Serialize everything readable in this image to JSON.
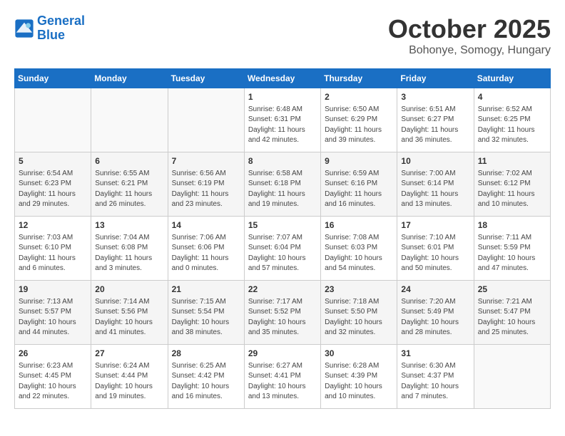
{
  "header": {
    "logo_line1": "General",
    "logo_line2": "Blue",
    "month": "October 2025",
    "location": "Bohonye, Somogy, Hungary"
  },
  "weekdays": [
    "Sunday",
    "Monday",
    "Tuesday",
    "Wednesday",
    "Thursday",
    "Friday",
    "Saturday"
  ],
  "weeks": [
    [
      {
        "day": "",
        "text": ""
      },
      {
        "day": "",
        "text": ""
      },
      {
        "day": "",
        "text": ""
      },
      {
        "day": "1",
        "text": "Sunrise: 6:48 AM\nSunset: 6:31 PM\nDaylight: 11 hours\nand 42 minutes."
      },
      {
        "day": "2",
        "text": "Sunrise: 6:50 AM\nSunset: 6:29 PM\nDaylight: 11 hours\nand 39 minutes."
      },
      {
        "day": "3",
        "text": "Sunrise: 6:51 AM\nSunset: 6:27 PM\nDaylight: 11 hours\nand 36 minutes."
      },
      {
        "day": "4",
        "text": "Sunrise: 6:52 AM\nSunset: 6:25 PM\nDaylight: 11 hours\nand 32 minutes."
      }
    ],
    [
      {
        "day": "5",
        "text": "Sunrise: 6:54 AM\nSunset: 6:23 PM\nDaylight: 11 hours\nand 29 minutes."
      },
      {
        "day": "6",
        "text": "Sunrise: 6:55 AM\nSunset: 6:21 PM\nDaylight: 11 hours\nand 26 minutes."
      },
      {
        "day": "7",
        "text": "Sunrise: 6:56 AM\nSunset: 6:19 PM\nDaylight: 11 hours\nand 23 minutes."
      },
      {
        "day": "8",
        "text": "Sunrise: 6:58 AM\nSunset: 6:18 PM\nDaylight: 11 hours\nand 19 minutes."
      },
      {
        "day": "9",
        "text": "Sunrise: 6:59 AM\nSunset: 6:16 PM\nDaylight: 11 hours\nand 16 minutes."
      },
      {
        "day": "10",
        "text": "Sunrise: 7:00 AM\nSunset: 6:14 PM\nDaylight: 11 hours\nand 13 minutes."
      },
      {
        "day": "11",
        "text": "Sunrise: 7:02 AM\nSunset: 6:12 PM\nDaylight: 11 hours\nand 10 minutes."
      }
    ],
    [
      {
        "day": "12",
        "text": "Sunrise: 7:03 AM\nSunset: 6:10 PM\nDaylight: 11 hours\nand 6 minutes."
      },
      {
        "day": "13",
        "text": "Sunrise: 7:04 AM\nSunset: 6:08 PM\nDaylight: 11 hours\nand 3 minutes."
      },
      {
        "day": "14",
        "text": "Sunrise: 7:06 AM\nSunset: 6:06 PM\nDaylight: 11 hours\nand 0 minutes."
      },
      {
        "day": "15",
        "text": "Sunrise: 7:07 AM\nSunset: 6:04 PM\nDaylight: 10 hours\nand 57 minutes."
      },
      {
        "day": "16",
        "text": "Sunrise: 7:08 AM\nSunset: 6:03 PM\nDaylight: 10 hours\nand 54 minutes."
      },
      {
        "day": "17",
        "text": "Sunrise: 7:10 AM\nSunset: 6:01 PM\nDaylight: 10 hours\nand 50 minutes."
      },
      {
        "day": "18",
        "text": "Sunrise: 7:11 AM\nSunset: 5:59 PM\nDaylight: 10 hours\nand 47 minutes."
      }
    ],
    [
      {
        "day": "19",
        "text": "Sunrise: 7:13 AM\nSunset: 5:57 PM\nDaylight: 10 hours\nand 44 minutes."
      },
      {
        "day": "20",
        "text": "Sunrise: 7:14 AM\nSunset: 5:56 PM\nDaylight: 10 hours\nand 41 minutes."
      },
      {
        "day": "21",
        "text": "Sunrise: 7:15 AM\nSunset: 5:54 PM\nDaylight: 10 hours\nand 38 minutes."
      },
      {
        "day": "22",
        "text": "Sunrise: 7:17 AM\nSunset: 5:52 PM\nDaylight: 10 hours\nand 35 minutes."
      },
      {
        "day": "23",
        "text": "Sunrise: 7:18 AM\nSunset: 5:50 PM\nDaylight: 10 hours\nand 32 minutes."
      },
      {
        "day": "24",
        "text": "Sunrise: 7:20 AM\nSunset: 5:49 PM\nDaylight: 10 hours\nand 28 minutes."
      },
      {
        "day": "25",
        "text": "Sunrise: 7:21 AM\nSunset: 5:47 PM\nDaylight: 10 hours\nand 25 minutes."
      }
    ],
    [
      {
        "day": "26",
        "text": "Sunrise: 6:23 AM\nSunset: 4:45 PM\nDaylight: 10 hours\nand 22 minutes."
      },
      {
        "day": "27",
        "text": "Sunrise: 6:24 AM\nSunset: 4:44 PM\nDaylight: 10 hours\nand 19 minutes."
      },
      {
        "day": "28",
        "text": "Sunrise: 6:25 AM\nSunset: 4:42 PM\nDaylight: 10 hours\nand 16 minutes."
      },
      {
        "day": "29",
        "text": "Sunrise: 6:27 AM\nSunset: 4:41 PM\nDaylight: 10 hours\nand 13 minutes."
      },
      {
        "day": "30",
        "text": "Sunrise: 6:28 AM\nSunset: 4:39 PM\nDaylight: 10 hours\nand 10 minutes."
      },
      {
        "day": "31",
        "text": "Sunrise: 6:30 AM\nSunset: 4:37 PM\nDaylight: 10 hours\nand 7 minutes."
      },
      {
        "day": "",
        "text": ""
      }
    ]
  ]
}
